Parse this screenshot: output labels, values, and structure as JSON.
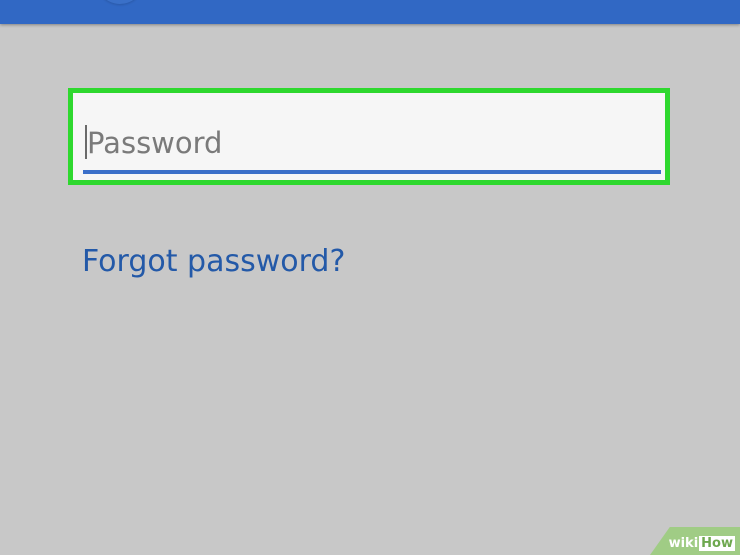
{
  "app_bar": {
    "color": "#3168c4"
  },
  "password_field": {
    "placeholder": "Password",
    "value": "",
    "highlight_color": "#2ed82e",
    "underline_color": "#3a6fc9"
  },
  "forgot_link": {
    "label": "Forgot password?",
    "color": "#2359a8"
  },
  "watermark": {
    "brand_part1": "wiki",
    "brand_part2": "How"
  }
}
